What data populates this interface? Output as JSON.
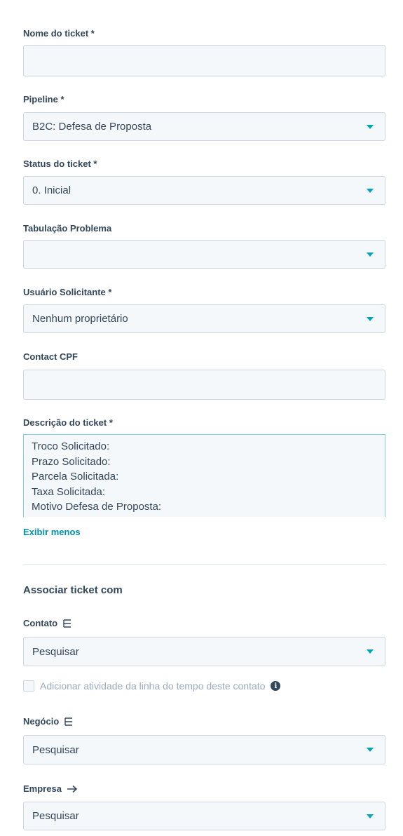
{
  "fields": {
    "ticket_name": {
      "label": "Nome do ticket *",
      "value": ""
    },
    "pipeline": {
      "label": "Pipeline *",
      "value": "B2C: Defesa de Proposta"
    },
    "status": {
      "label": "Status do ticket *",
      "value": "0. Inicial"
    },
    "tabulacao": {
      "label": "Tabulação Problema",
      "value": ""
    },
    "usuario": {
      "label": "Usuário Solicitante *",
      "value": "Nenhum proprietário"
    },
    "cpf": {
      "label": "Contact CPF",
      "value": ""
    },
    "descricao": {
      "label": "Descrição do ticket *",
      "lines": [
        "Troco Solicitado:",
        "Prazo Solicitado:",
        "Parcela Solicitada:",
        "Taxa Solicitada:",
        "Motivo Defesa de Proposta:"
      ]
    }
  },
  "show_less_link": "Exibir menos",
  "associate": {
    "title": "Associar ticket com",
    "contato": {
      "label": "Contato",
      "placeholder": "Pesquisar"
    },
    "checkbox_label": "Adicionar atividade da linha do tempo deste contato",
    "negocio": {
      "label": "Negócio",
      "placeholder": "Pesquisar"
    },
    "empresa": {
      "label": "Empresa",
      "placeholder": "Pesquisar"
    }
  },
  "colors": {
    "accent": "#00a4bd",
    "link": "#0091ae",
    "field_bg": "#f5f8fa",
    "border": "#cbd6e2",
    "text": "#33475b"
  }
}
